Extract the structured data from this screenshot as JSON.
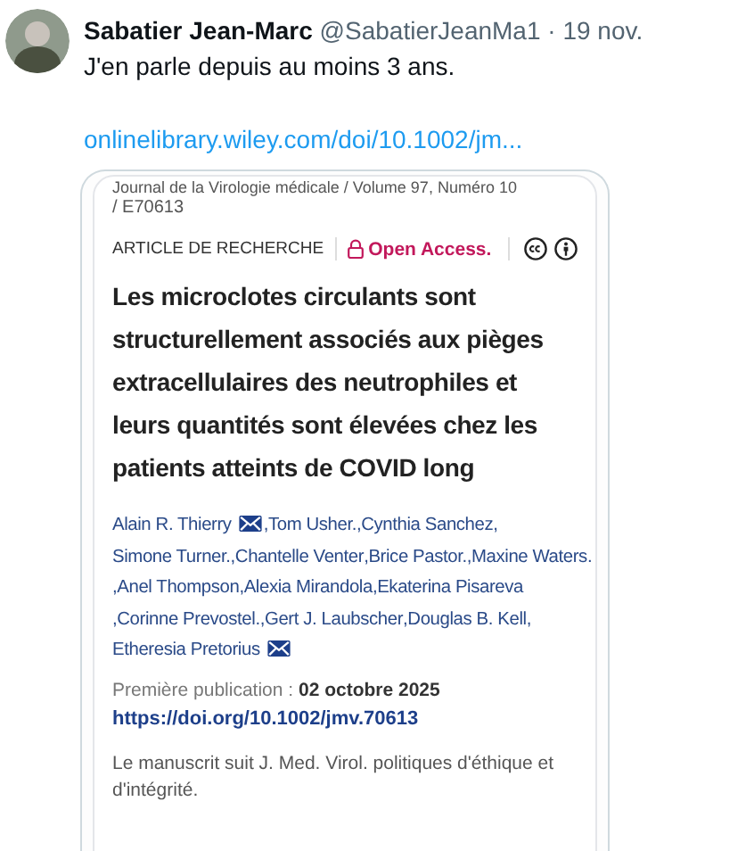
{
  "tweet": {
    "author": "Sabatier Jean-Marc",
    "handle": "@SabatierJeanMa1",
    "separator": "·",
    "date": "19 nov.",
    "text": "J'en parle depuis au moins 3 ans.",
    "link": "onlinelibrary.wiley.com/doi/10.1002/jm..."
  },
  "article": {
    "journal": "Journal de la Virologie médicale / Volume 97, Numéro 10",
    "article_id": "/ E70613",
    "type": "ARTICLE DE RECHERCHE",
    "access": "Open Access.",
    "title": "Les microclotes circulants sont structurellement associés aux pièges extracellulaires des neutrophiles et leurs quantités sont élevées chez les patients atteints de COVID long",
    "authors": [
      {
        "name": "Alain R. Thierry",
        "mail": true
      },
      {
        "name": ",Tom Usher.",
        "mail": false
      },
      {
        "name": ",Cynthia Sanchez,",
        "mail": false
      },
      {
        "name": "Simone Turner.",
        "mail": false
      },
      {
        "name": ",Chantelle Venter",
        "mail": false
      },
      {
        "name": ",Brice Pastor.",
        "mail": false
      },
      {
        "name": ",Maxine Waters.",
        "mail": false
      },
      {
        "name": ",Anel Thompson",
        "mail": false
      },
      {
        "name": ",Alexia Mirandola,",
        "mail": false
      },
      {
        "name": "Ekaterina Pisareva",
        "mail": false
      },
      {
        "name": ",Corinne Prevostel.,",
        "mail": false
      },
      {
        "name": "Gert J. Laubscher",
        "mail": false
      },
      {
        "name": ",Douglas B. Kell,",
        "mail": false
      },
      {
        "name": "Etheresia Pretorius",
        "mail": true
      }
    ],
    "published_label": "Première publication :",
    "published_date": "02 octobre 2025",
    "doi": "https://doi.org/10.1002/jmv.70613",
    "note": "Le manuscrit suit J. Med. Virol. politiques d'éthique et d'intégrité."
  }
}
